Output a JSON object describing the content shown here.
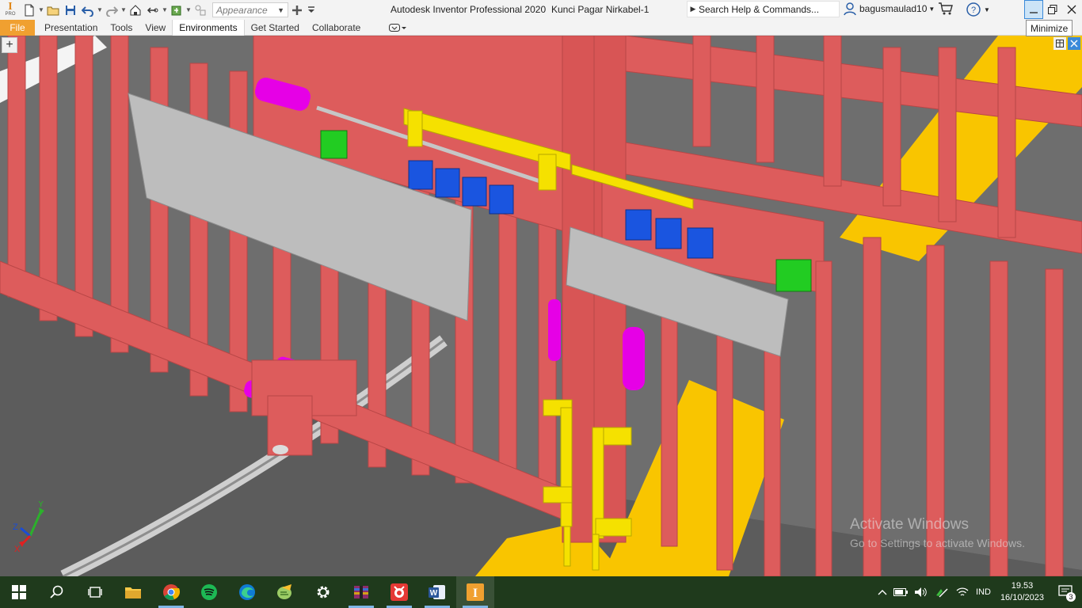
{
  "titlebar": {
    "app_title": "Autodesk Inventor Professional 2020",
    "document_title": "Kunci Pagar Nirkabel-1",
    "appearance_value": "Appearance",
    "search_placeholder": "Search Help & Commands...",
    "username": "bagusmaulad10",
    "logo_letter": "I",
    "logo_sub": "PRO",
    "minimize_tooltip": "Minimize"
  },
  "ribbon": {
    "tabs": [
      {
        "label": "File",
        "state": "file"
      },
      {
        "label": "Presentation",
        "state": "normal"
      },
      {
        "label": "Tools",
        "state": "normal"
      },
      {
        "label": "View",
        "state": "normal"
      },
      {
        "label": "Environments",
        "state": "active"
      },
      {
        "label": "Get Started",
        "state": "normal"
      },
      {
        "label": "Collaborate",
        "state": "normal"
      }
    ]
  },
  "viewport": {
    "new_tab_symbol": "+",
    "triad_labels": {
      "x": "X",
      "y": "Y",
      "z": "Z"
    },
    "watermark_line1": "Activate Windows",
    "watermark_line2": "Go to Settings to activate Windows."
  },
  "taskbar": {
    "apps": [
      "start",
      "search",
      "task-view",
      "file-explorer",
      "chrome",
      "spotify",
      "edge",
      "notepad-plus-plus",
      "settings",
      "winrar",
      "app-red",
      "word",
      "inventor"
    ],
    "language": "IND",
    "time": "19.53",
    "date": "16/10/2023",
    "notification_count": "3"
  },
  "colors": {
    "gate_red": "#dd5c5c",
    "latch_yellow": "#f5e100",
    "floor_yellow": "#f9c500",
    "actuator_magenta": "#e600e6",
    "module_blue": "#1a55e0",
    "module_green": "#22cc22",
    "plate_gray": "#bdbdbd",
    "file_tab": "#f0a030"
  }
}
